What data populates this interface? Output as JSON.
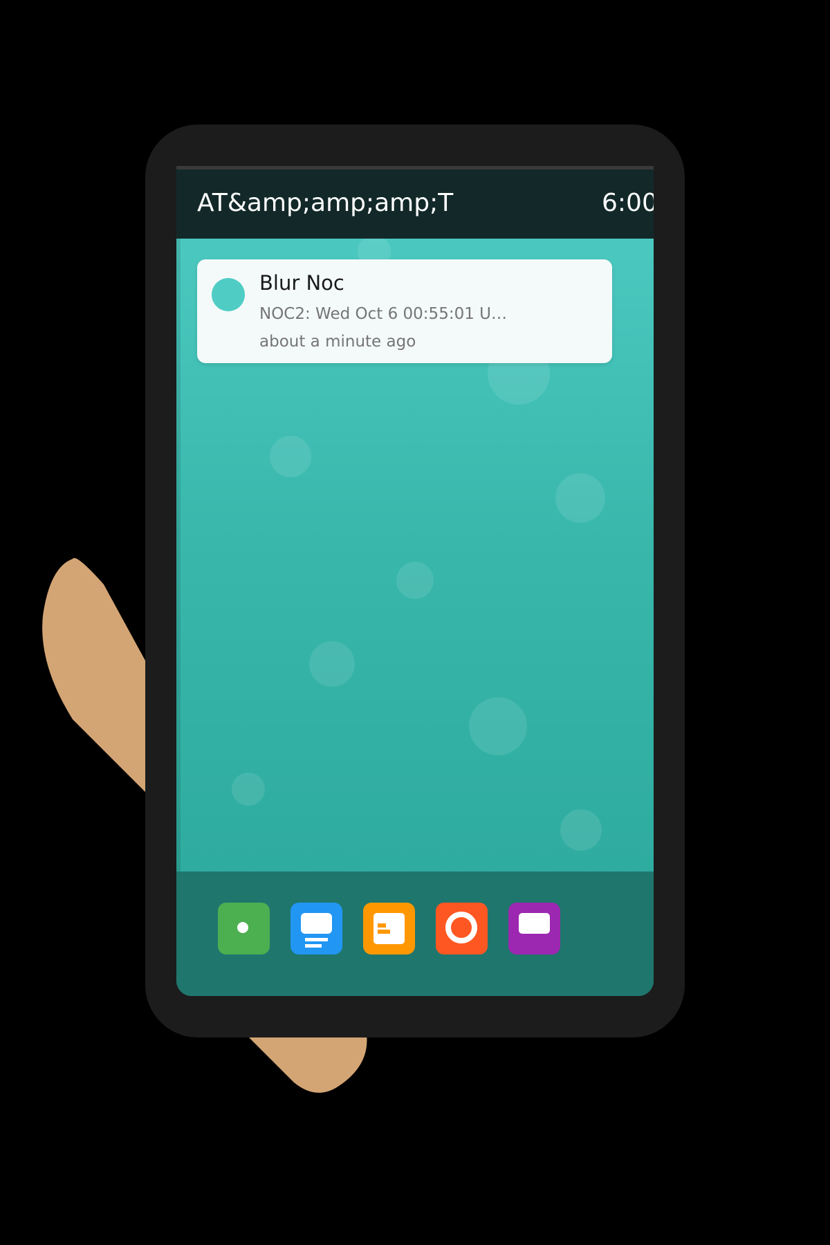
{
  "status_bar": {
    "carrier": "AT&amp;amp;amp;T",
    "time": "6:00"
  },
  "notification": {
    "title": "Blur Noc",
    "body": "NOC2: Wed Oct 6 00:55:01 U…",
    "timestamp": "about a minute ago"
  },
  "dock": {
    "apps": [
      {
        "icon": "phone-app-icon",
        "color": "#4caf50"
      },
      {
        "icon": "messages-app-icon",
        "color": "#2196f3"
      },
      {
        "icon": "contacts-app-icon",
        "color": "#ff9800"
      },
      {
        "icon": "browser-app-icon",
        "color": "#ff5722"
      },
      {
        "icon": "email-app-icon",
        "color": "#9c27b0"
      }
    ]
  },
  "colors": {
    "wallpaper_top": "#4fcdc5",
    "wallpaper_bottom": "#2ba79b",
    "status_bar": "#132929",
    "dock": "#1f766d",
    "hand": "#d4a574"
  }
}
